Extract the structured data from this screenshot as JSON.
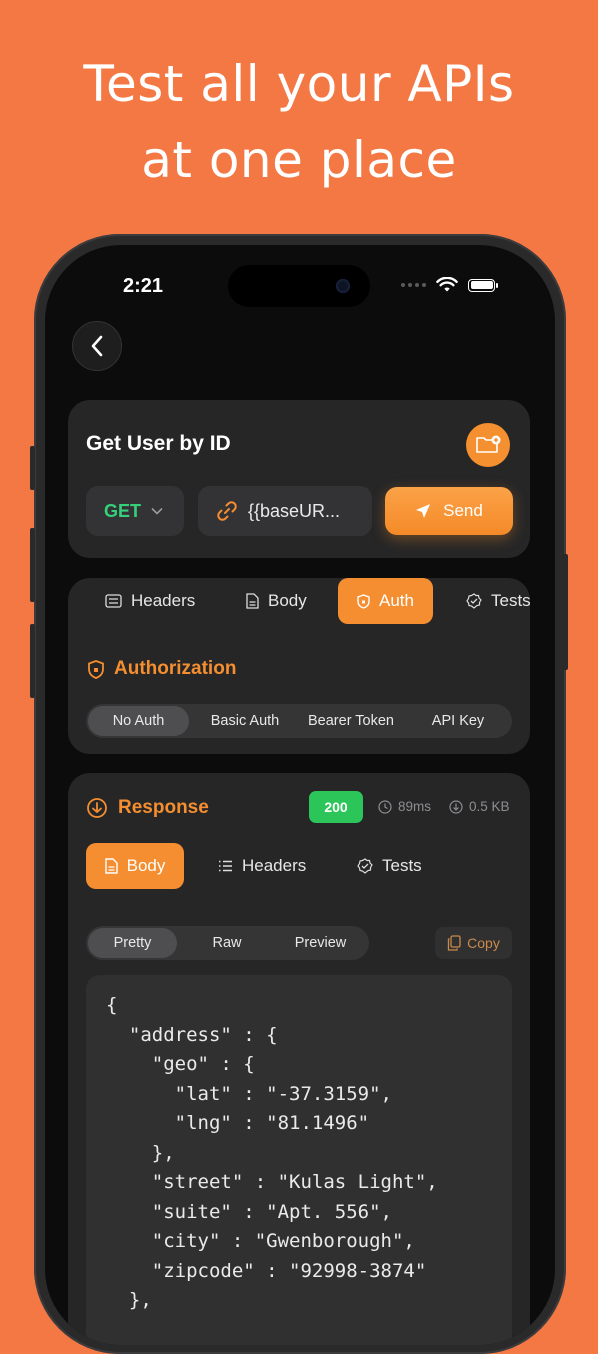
{
  "headline": {
    "line1": "Test all your APIs",
    "line2": "at one place"
  },
  "status": {
    "time": "2:21"
  },
  "request": {
    "title": "Get User by ID",
    "method": "GET",
    "url": "{{baseUR...",
    "send_label": "Send"
  },
  "tabs": [
    {
      "label": "Headers"
    },
    {
      "label": "Body"
    },
    {
      "label": "Auth"
    },
    {
      "label": "Tests"
    }
  ],
  "auth": {
    "title": "Authorization",
    "options": [
      "No Auth",
      "Basic Auth",
      "Bearer Token",
      "API Key"
    ],
    "selected": "No Auth"
  },
  "response": {
    "title": "Response",
    "status_code": "200",
    "time": "89ms",
    "size": "0.5 KB",
    "tabs": [
      "Body",
      "Headers",
      "Tests"
    ],
    "views": [
      "Pretty",
      "Raw",
      "Preview"
    ],
    "copy_label": "Copy",
    "code": "{\n  \"address\" : {\n    \"geo\" : {\n      \"lat\" : \"-37.3159\",\n      \"lng\" : \"81.1496\"\n    },\n    \"street\" : \"Kulas Light\",\n    \"suite\" : \"Apt. 556\",\n    \"city\" : \"Gwenborough\",\n    \"zipcode\" : \"92998-3874\"\n  },"
  },
  "colors": {
    "background": "#f37844",
    "accent": "#f48e30",
    "success": "#2bc55a",
    "method": "#35d07a"
  }
}
